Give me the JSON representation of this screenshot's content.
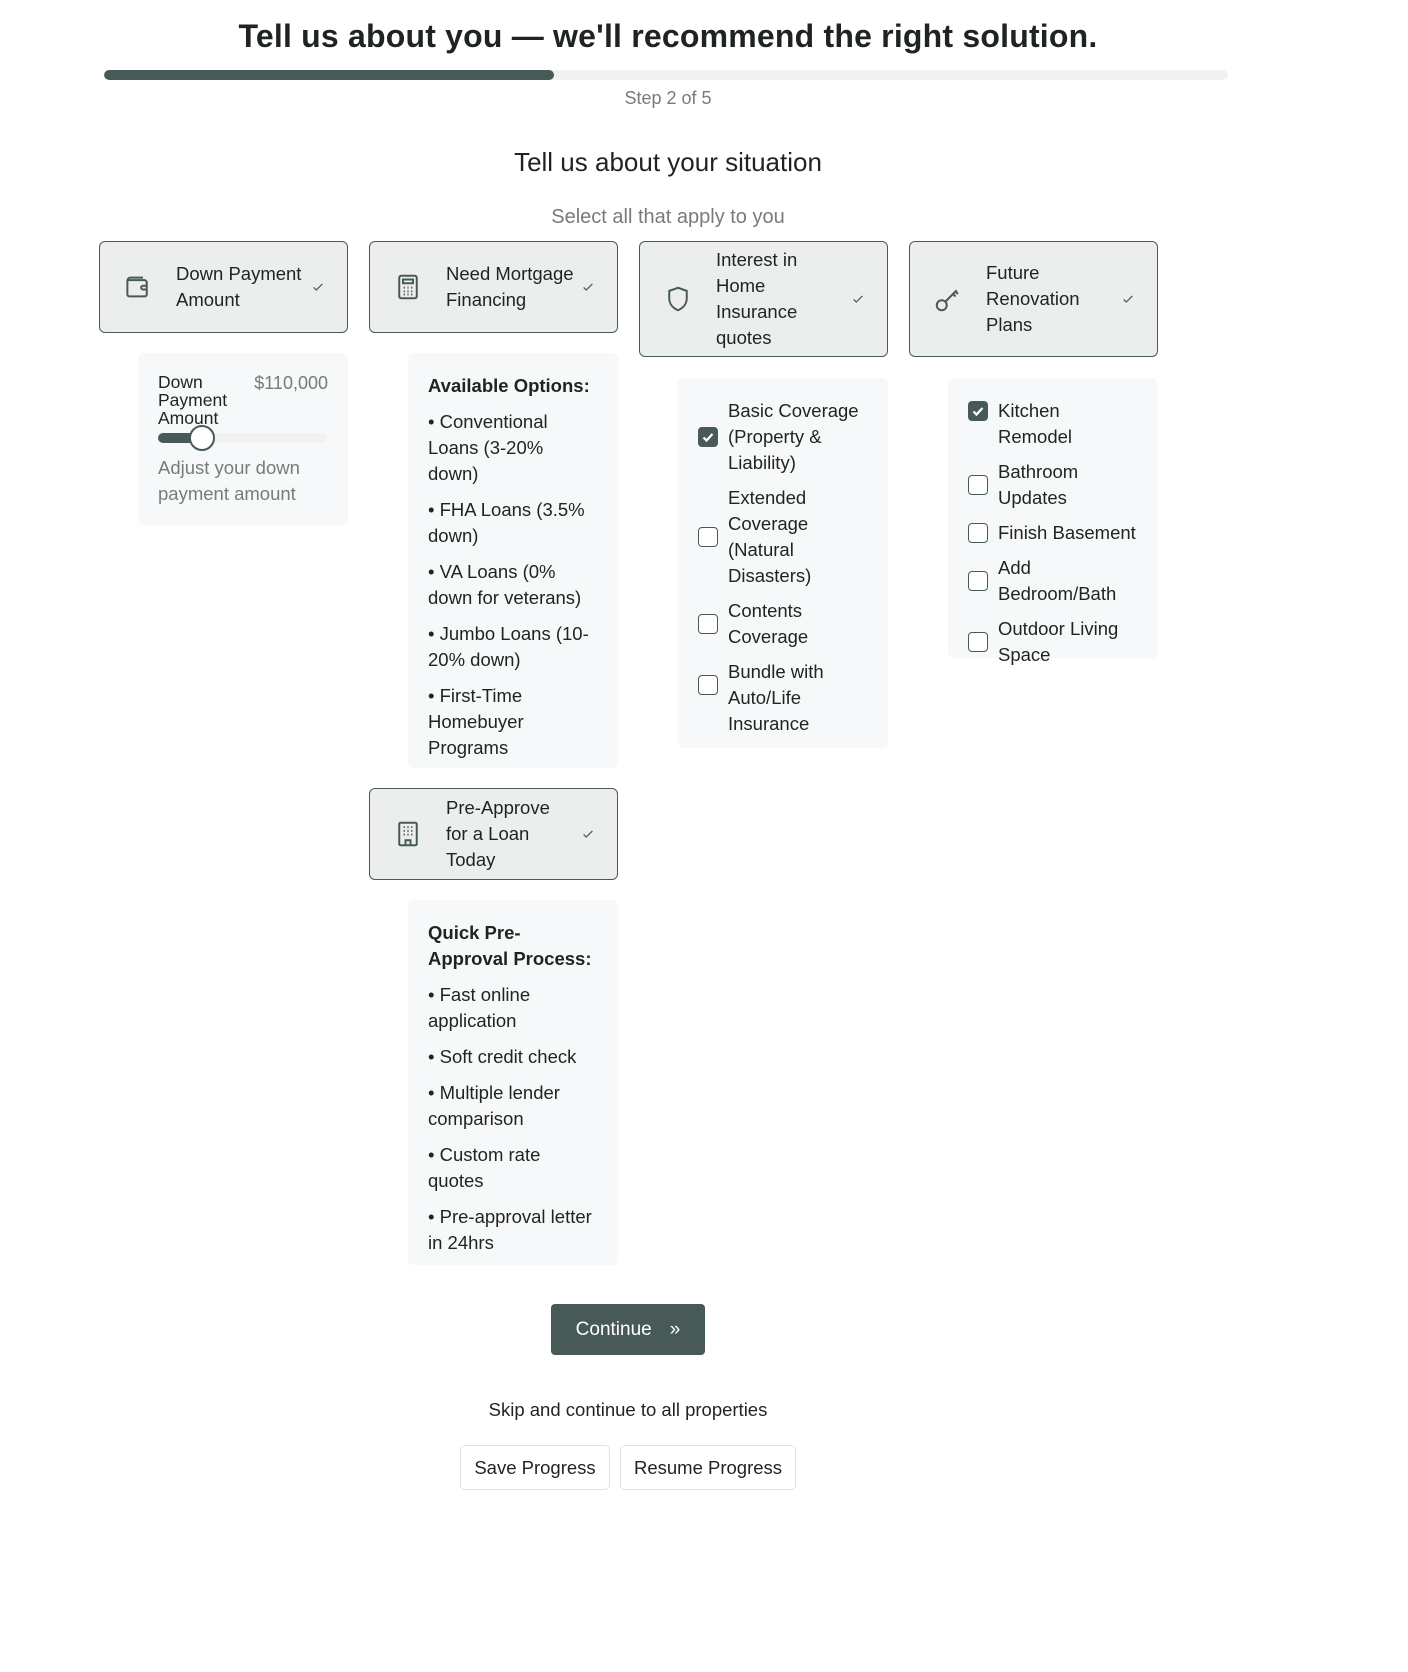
{
  "header": {
    "title": "Tell us about you — we'll recommend the right solution.",
    "progress_fraction": 0.4,
    "step_label": "Step 2 of 5"
  },
  "section": {
    "title": "Tell us about your situation",
    "subtitle": "Select all that apply to you"
  },
  "cards": {
    "down_payment": {
      "label": "Down Payment Amount",
      "icon": "wallet-icon"
    },
    "mortgage": {
      "label": "Need Mortgage Financing",
      "icon": "calculator-icon"
    },
    "insurance": {
      "label": "Interest in Home Insurance quotes",
      "icon": "shield-icon"
    },
    "renovation": {
      "label": "Future Renovation Plans",
      "icon": "key-icon"
    },
    "preapprove": {
      "label": "Pre-Approve for a Loan Today",
      "icon": "building-icon"
    }
  },
  "down_payment_panel": {
    "label": "Down Payment Amount",
    "value": "$110,000",
    "slider_fraction": 0.26,
    "help": "Adjust your down payment amount"
  },
  "mortgage_panel": {
    "heading": "Available Options:",
    "items": [
      "• Conventional Loans (3-20% down)",
      "• FHA Loans (3.5% down)",
      "• VA Loans (0% down for veterans)",
      "• Jumbo Loans (10-20% down)",
      "• First-Time Homebuyer Programs"
    ]
  },
  "insurance_panel": {
    "options": [
      {
        "label": "Basic Coverage (Property & Liability)",
        "checked": true
      },
      {
        "label": "Extended Coverage (Natural Disasters)",
        "checked": false
      },
      {
        "label": "Contents Coverage",
        "checked": false
      },
      {
        "label": "Bundle with Auto/Life Insurance",
        "checked": false
      }
    ]
  },
  "renovation_panel": {
    "options": [
      {
        "label": "Kitchen Remodel",
        "checked": true
      },
      {
        "label": "Bathroom Updates",
        "checked": false
      },
      {
        "label": "Finish Basement",
        "checked": false
      },
      {
        "label": "Add Bedroom/Bath",
        "checked": false
      },
      {
        "label": "Outdoor Living Space",
        "checked": false
      }
    ]
  },
  "preapprove_panel": {
    "heading": "Quick Pre-Approval Process:",
    "items": [
      "• Fast online application",
      "• Soft credit check",
      "• Multiple lender comparison",
      "• Custom rate quotes",
      "• Pre-approval letter in 24hrs"
    ]
  },
  "actions": {
    "continue_label": "Continue",
    "continue_icon": "double-chevron-right-icon",
    "skip_label": "Skip and continue to all properties",
    "save_label": "Save Progress",
    "resume_label": "Resume Progress"
  },
  "colors": {
    "accent": "#485a58",
    "card_bg": "#eceeed",
    "panel_bg": "#f7f8f9",
    "muted_text": "#777c79"
  }
}
